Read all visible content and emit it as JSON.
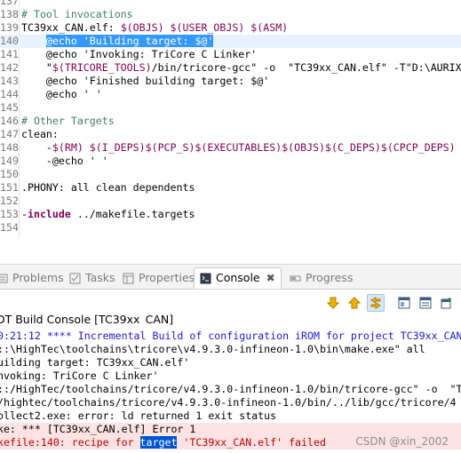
{
  "editor": {
    "lines": [
      {
        "n": "137",
        "parts": [
          {
            "t": "",
            "c": "black"
          }
        ]
      },
      {
        "n": "138",
        "parts": [
          {
            "t": "# Tool invocations",
            "c": "comment"
          }
        ]
      },
      {
        "n": "139",
        "parts": [
          {
            "t": "TC39xx_CAN.elf: ",
            "c": "black"
          },
          {
            "t": "$(OBJS) $(USER_OBJS) $(ASM)",
            "c": "var"
          }
        ]
      },
      {
        "n": "140",
        "current": true,
        "parts": [
          {
            "t": "    ",
            "c": "black"
          },
          {
            "t": "@echo 'Building target: $@'",
            "c": "sel"
          }
        ]
      },
      {
        "n": "141",
        "parts": [
          {
            "t": "    @echo 'Invoking: TriCore C Linker'",
            "c": "black"
          }
        ]
      },
      {
        "n": "142",
        "parts": [
          {
            "t": "    \"",
            "c": "black"
          },
          {
            "t": "$(TRICORE_TOOLS)",
            "c": "var"
          },
          {
            "t": "/bin/tricore-gcc\" -o  \"TC39xx_CAN.elf\" -T\"D:\\AURIX",
            "c": "black"
          }
        ]
      },
      {
        "n": "143",
        "parts": [
          {
            "t": "    @echo 'Finished building target: $@'",
            "c": "black"
          }
        ]
      },
      {
        "n": "144",
        "parts": [
          {
            "t": "    @echo ' '",
            "c": "black"
          }
        ]
      },
      {
        "n": "145",
        "parts": [
          {
            "t": "",
            "c": "black"
          }
        ]
      },
      {
        "n": "146",
        "parts": [
          {
            "t": "# Other Targets",
            "c": "comment"
          }
        ]
      },
      {
        "n": "147",
        "parts": [
          {
            "t": "clean:",
            "c": "black"
          }
        ]
      },
      {
        "n": "148",
        "parts": [
          {
            "t": "    -",
            "c": "black"
          },
          {
            "t": "$(RM) $(I_DEPS)$(PCP_S)$(EXECUTABLES)$(OBJS)$(C_DEPS)$(CPCP_DEPS)",
            "c": "var"
          }
        ]
      },
      {
        "n": "149",
        "parts": [
          {
            "t": "    -@echo ' '",
            "c": "black"
          }
        ]
      },
      {
        "n": "150",
        "parts": [
          {
            "t": "",
            "c": "black"
          }
        ]
      },
      {
        "n": "151",
        "parts": [
          {
            "t": ".PHONY: all clean dependents",
            "c": "black"
          }
        ]
      },
      {
        "n": "152",
        "parts": [
          {
            "t": "",
            "c": "black"
          }
        ]
      },
      {
        "n": "153",
        "parts": [
          {
            "t": "-",
            "c": "black"
          },
          {
            "t": "include",
            "c": "kw"
          },
          {
            "t": " ../makefile.targets",
            "c": "black"
          }
        ]
      },
      {
        "n": "154",
        "parts": [
          {
            "t": "",
            "c": "black"
          }
        ]
      }
    ]
  },
  "views": {
    "tabs": [
      {
        "label": "Problems",
        "icon": "problems-icon",
        "active": false
      },
      {
        "label": "Tasks",
        "icon": "tasks-icon",
        "active": false
      },
      {
        "label": "Properties",
        "icon": "properties-icon",
        "active": false
      },
      {
        "label": "Console",
        "icon": "console-icon",
        "active": true,
        "close": "✖"
      },
      {
        "label": "Progress",
        "icon": "progress-icon",
        "active": false
      }
    ]
  },
  "console": {
    "title": "DT Build Console [TC39xx_CAN]",
    "lines": [
      {
        "t": "0:21:12 **** Incremental Build of configuration iROM for project TC39xx_CAN",
        "c": "blue"
      },
      {
        "t": "::\\HighTec\\toolchains\\tricore\\v4.9.3.0-infineon-1.0\\bin\\make.exe\" all",
        "c": "black"
      },
      {
        "t": "uilding target: TC39xx_CAN.elf'",
        "c": "black"
      },
      {
        "t": "nvoking: TriCore C Linker'",
        "c": "black"
      },
      {
        "t": "::/HighTec/toolchains/tricore/v4.9.3.0-infineon-1.0/bin/tricore-gcc\" -o  \"T",
        "c": "black"
      },
      {
        "t": "/hightec/toolchains/tricore/v4.9.3.0-infineon-1.0/bin/../lib/gcc/tricore/4",
        "c": "black"
      },
      {
        "t": "ollect2.exe: error: ld returned 1 exit status",
        "c": "black"
      },
      {
        "t": "ke: *** [TC39xx_CAN.elf] Error 1",
        "c": "black",
        "err": true
      },
      {
        "t": "kefile:140: recipe for ",
        "t2": "target",
        "t3": " 'TC39xx_CAN.elf' failed",
        "c": "red",
        "err": true
      }
    ]
  },
  "watermark": "CSDN @xin_2002",
  "colors": {
    "comment": "#3f7f5f",
    "variable": "#7f0055",
    "selection": "#3399ff",
    "console_info": "#1a1ad1",
    "console_error": "#c00000"
  }
}
